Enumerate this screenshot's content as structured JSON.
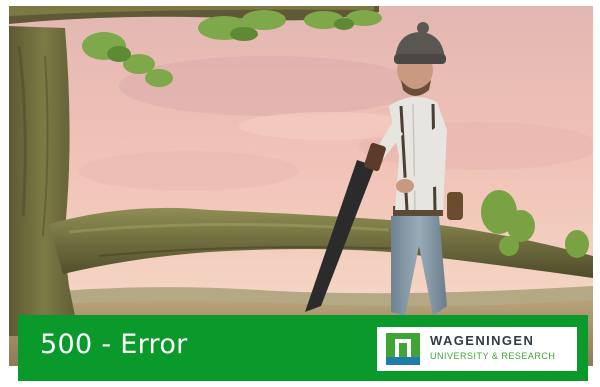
{
  "hero_image": {
    "subject": "man-sawing-branch-illustration"
  },
  "error": {
    "title": "500 - Error"
  },
  "logo": {
    "name": "WAGENINGEN",
    "subtitle": "UNIVERSITY & RESEARCH",
    "mark_icon": "wur-logo-icon"
  },
  "colors": {
    "bar": "#0a9a2c",
    "logo_green": "#3fa535",
    "logo_blue": "#1e7ea8",
    "logo_text": "#2c3e44"
  }
}
